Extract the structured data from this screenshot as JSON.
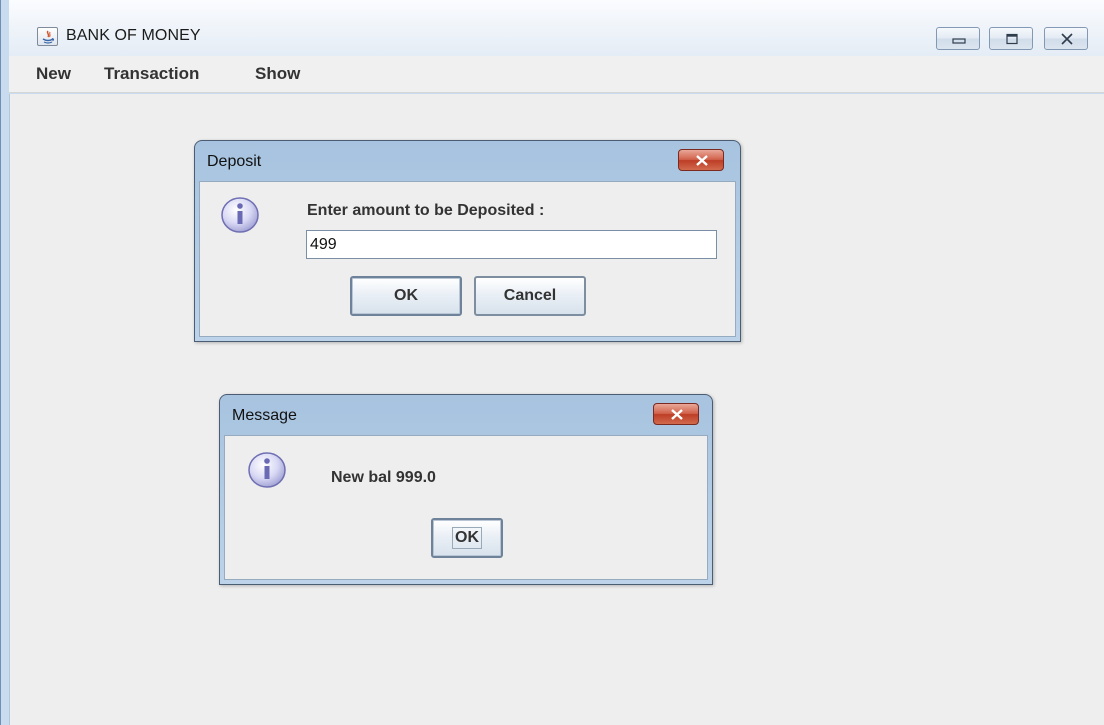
{
  "window": {
    "title": "BANK OF MONEY",
    "icons": [
      "java-app-icon",
      "minimize-icon",
      "maximize-icon",
      "close-icon"
    ]
  },
  "menu": {
    "items": [
      {
        "label": "New"
      },
      {
        "label": "Transaction"
      },
      {
        "label": "Show"
      }
    ]
  },
  "deposit_dialog": {
    "title": "Deposit",
    "prompt": "Enter amount to be Deposited :",
    "amount_value": "499",
    "ok_label": "OK",
    "cancel_label": "Cancel",
    "icon": "info-icon"
  },
  "message_dialog": {
    "title": "Message",
    "text": "New bal 999.0",
    "ok_label": "OK",
    "icon": "info-icon"
  },
  "colors": {
    "dialog_frame": "#a7c3df",
    "close_button": "#d1614a",
    "content_bg": "#eeeeee",
    "text": "#333333"
  }
}
